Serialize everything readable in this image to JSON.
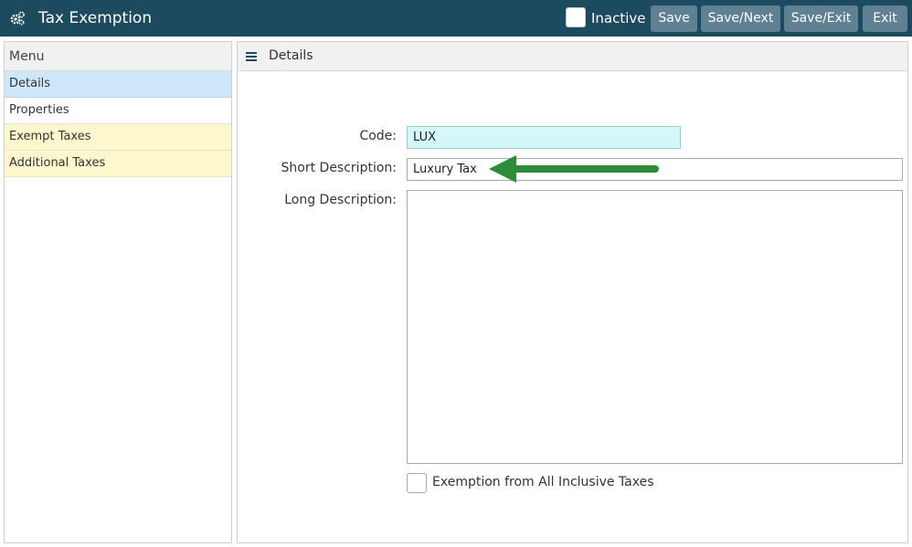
{
  "header": {
    "title": "Tax Exemption",
    "inactive_label": "Inactive",
    "inactive_checked": false,
    "buttons": {
      "save": "Save",
      "save_next": "Save/Next",
      "save_exit": "Save/Exit",
      "exit": "Exit"
    },
    "icon": "gears-icon"
  },
  "sidebar": {
    "title": "Menu",
    "items": [
      {
        "label": "Details",
        "state": "active"
      },
      {
        "label": "Properties",
        "state": "normal"
      },
      {
        "label": "Exempt Taxes",
        "state": "highlighted"
      },
      {
        "label": "Additional Taxes",
        "state": "highlighted"
      }
    ]
  },
  "panel": {
    "title": "Details",
    "icon": "hamburger-icon",
    "form": {
      "code_label": "Code:",
      "code_value": "LUX",
      "short_label": "Short Description:",
      "short_value": "Luxury Tax",
      "long_label": "Long Description:",
      "long_value": "",
      "exemption_label": "Exemption from All Inclusive Taxes",
      "exemption_checked": false
    }
  },
  "colors": {
    "header_bg": "#1c4a5f",
    "button_bg": "#5f8193",
    "active_item": "#cfe7fb",
    "highlight_item": "#fdf7cd",
    "code_field_bg": "#d4f7f9",
    "arrow": "#2e8b3a"
  }
}
